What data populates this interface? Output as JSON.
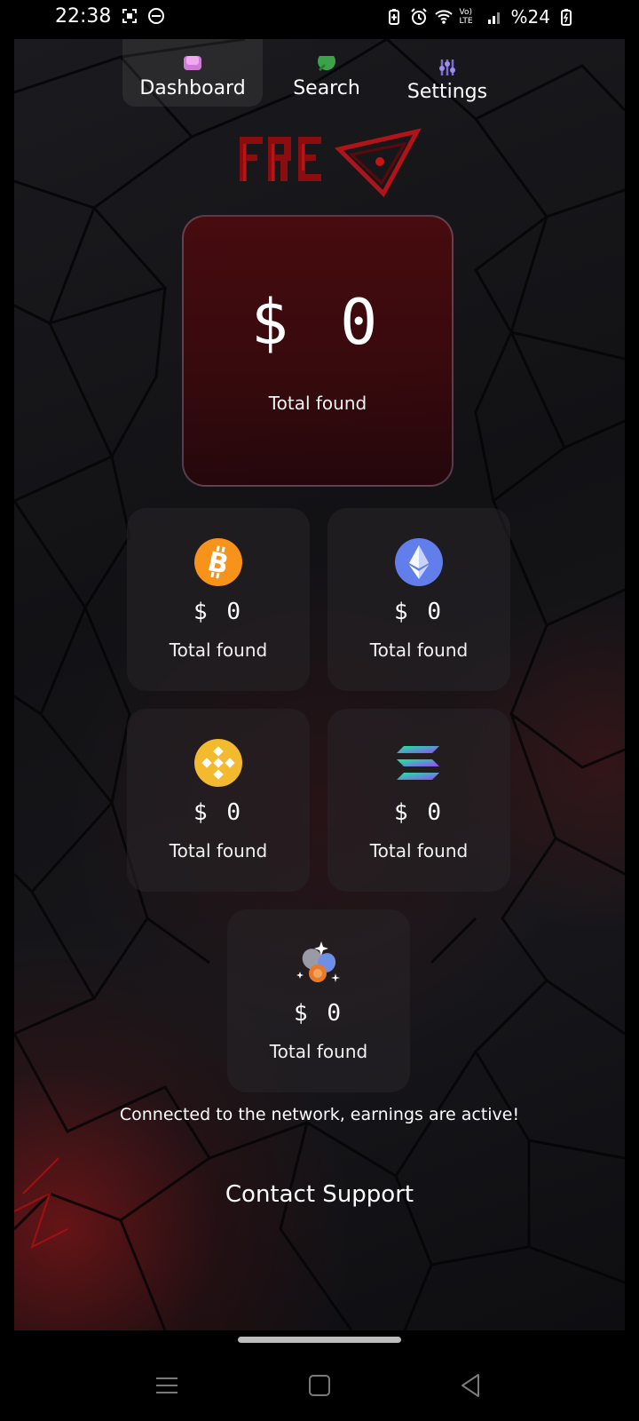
{
  "status_bar": {
    "time": "22:38",
    "battery": "%24",
    "network_label": "Vo) LTE",
    "left_icons": [
      "screenshot-icon",
      "dnd-icon"
    ],
    "right_icons": [
      "battery-saver-icon",
      "alarm-icon",
      "wifi-icon",
      "signal-icon",
      "battery-icon"
    ]
  },
  "nav": {
    "items": [
      {
        "label": "Dashboard",
        "icon": "dashboard-icon",
        "active": true
      },
      {
        "label": "Search",
        "icon": "search-icon",
        "active": false
      },
      {
        "label": "Settings",
        "icon": "sliders-icon",
        "active": false
      }
    ]
  },
  "main_card": {
    "amount": "$ 0",
    "label": "Total found"
  },
  "coins": [
    {
      "icon": "bitcoin-icon",
      "amount": "$ 0",
      "label": "Total found",
      "color": "#F7931A"
    },
    {
      "icon": "ethereum-icon",
      "amount": "$ 0",
      "label": "Total found",
      "color": "#627EEA"
    },
    {
      "icon": "binance-icon",
      "amount": "$ 0",
      "label": "Total found",
      "color": "#F3BA2F"
    },
    {
      "icon": "solana-icon",
      "amount": "$ 0",
      "label": "Total found",
      "color": "#14F195"
    },
    {
      "icon": "coins-icon",
      "amount": "$ 0",
      "label": "Total found",
      "color": "#E8792B"
    }
  ],
  "status_message": "Connected to the network, earnings are active!",
  "contact_label": "Contact Support",
  "colors": {
    "accent_red": "#C81414",
    "card_border": "#AAA0C8"
  }
}
